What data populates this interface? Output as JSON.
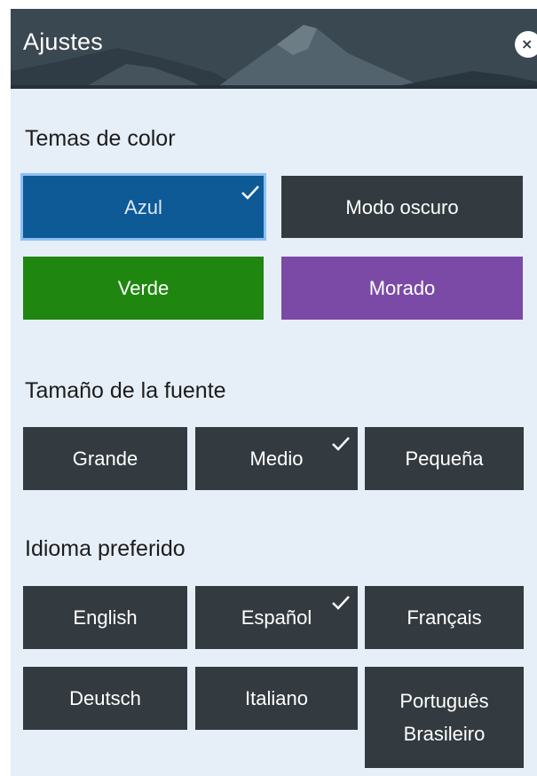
{
  "header": {
    "title": "Ajustes",
    "close_symbol": "×",
    "close_icon": "close-icon"
  },
  "color_themes": {
    "title": "Temas de color",
    "options": [
      {
        "label": "Azul",
        "color": "#0d5a96",
        "selected": true
      },
      {
        "label": "Modo oscuro",
        "color": "#333b40",
        "selected": false
      },
      {
        "label": "Verde",
        "color": "#1f8710",
        "selected": false
      },
      {
        "label": "Morado",
        "color": "#7b4aa6",
        "selected": false
      }
    ]
  },
  "font_size": {
    "title": "Tamaño de la fuente",
    "options": [
      {
        "label": "Grande",
        "selected": false
      },
      {
        "label": "Medio",
        "selected": true
      },
      {
        "label": "Pequeña",
        "selected": false
      }
    ]
  },
  "language": {
    "title": "Idioma preferido",
    "options": [
      {
        "label": "English",
        "selected": false
      },
      {
        "label": "Español",
        "selected": true
      },
      {
        "label": "Français",
        "selected": false
      },
      {
        "label": "Deutsch",
        "selected": false
      },
      {
        "label": "Italiano",
        "selected": false
      },
      {
        "label": "Português Brasileiro",
        "selected": false
      }
    ]
  },
  "colors": {
    "panel_bg": "#e6eef7",
    "button_dark": "#333b40",
    "focus_ring": "#8cc0f5"
  },
  "icons": {
    "selected_marker": "checkmark-icon"
  }
}
